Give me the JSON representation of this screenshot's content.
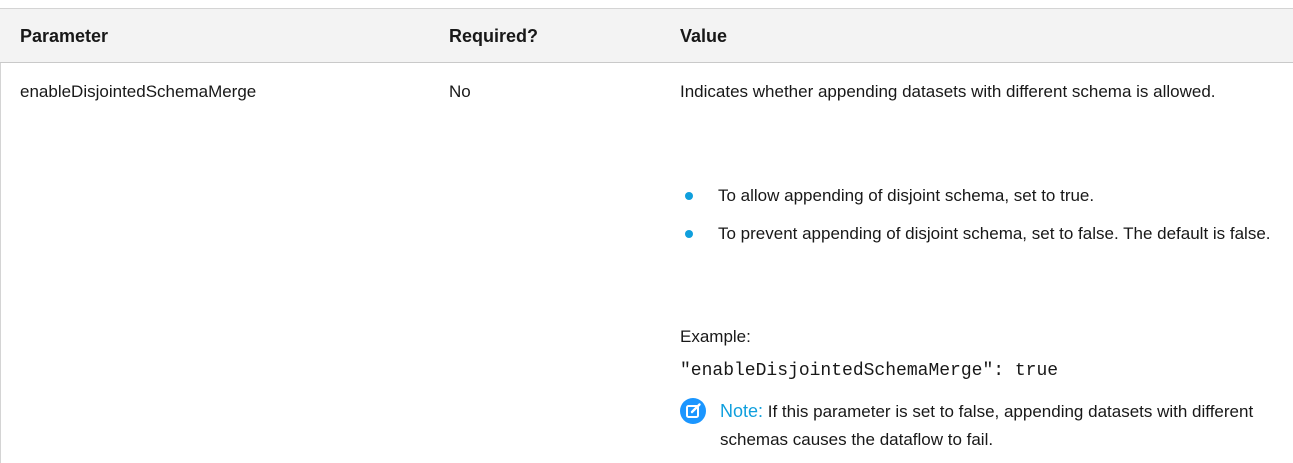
{
  "table": {
    "headers": {
      "parameter": "Parameter",
      "required": "Required?",
      "value": "Value"
    },
    "row": {
      "parameter": "enableDisjointedSchemaMerge",
      "required": "No",
      "description": "Indicates whether appending datasets with different schema is allowed.",
      "bullets": [
        "To allow appending of disjoint schema, set to true.",
        "To prevent appending of disjoint schema, set to false. The default is false."
      ],
      "example_label": "Example:",
      "example_code": "\"enableDisjointedSchemaMerge\": true",
      "note_label": "Note:",
      "note_text": "If this parameter is set to false, appending datasets with different schemas causes the dataflow to fail."
    }
  },
  "icons": {
    "note": "edit-note-icon"
  },
  "colors": {
    "header_bg": "#f3f3f3",
    "accent": "#0f9fdd",
    "note_icon": "#1b96ff"
  }
}
